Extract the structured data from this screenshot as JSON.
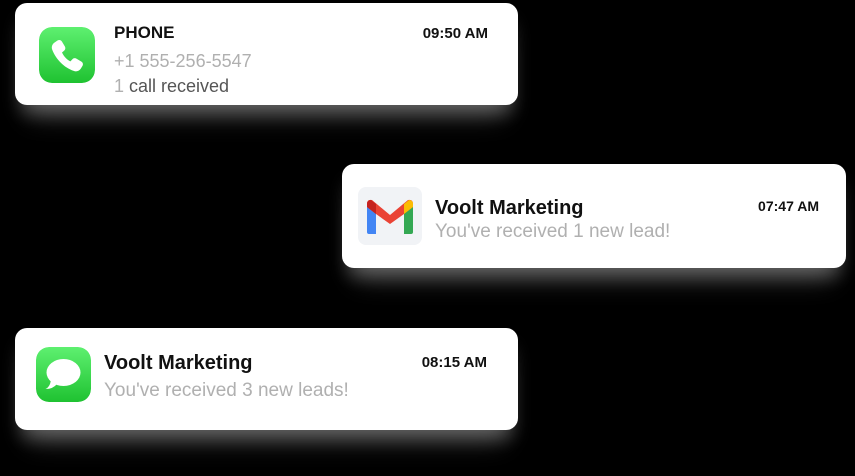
{
  "notifications": [
    {
      "app": "phone",
      "title": "PHONE",
      "time": "09:50 AM",
      "line1": "+1 555-256-5547",
      "line2_count": "1",
      "line2_text": " call received"
    },
    {
      "app": "gmail",
      "title": "Voolt Marketing",
      "time": "07:47 AM",
      "message": "You've received 1 new lead!"
    },
    {
      "app": "messages",
      "title": "Voolt Marketing",
      "time": "08:15 AM",
      "message": "You've received 3 new leads!"
    }
  ],
  "colors": {
    "phone_green_top": "#5ef070",
    "phone_green_bottom": "#1fc231",
    "gmail_red": "#ea4335",
    "gmail_blue": "#4285f4",
    "gmail_green": "#34a853",
    "gmail_yellow": "#fbbc04",
    "secondary_text": "#b0b0b0"
  },
  "icons": [
    "phone-app-icon",
    "gmail-app-icon",
    "messages-app-icon"
  ]
}
